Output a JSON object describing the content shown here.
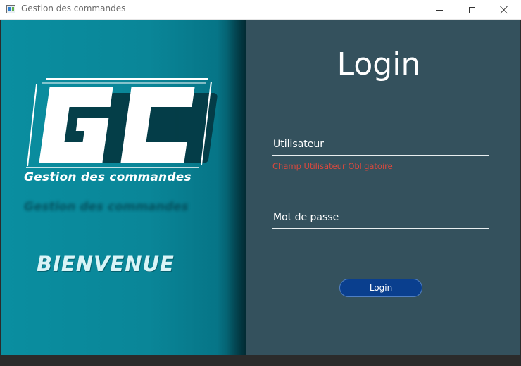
{
  "window": {
    "title": "Gestion des commandes",
    "icon": "app-window-icon",
    "controls": [
      "minimize-icon",
      "maximize-icon",
      "close-icon"
    ]
  },
  "branding": {
    "logo_letters": "GC",
    "logo_subtitle": "Gestion des commandes",
    "welcome": "BIENVENUE"
  },
  "login": {
    "title": "Login",
    "username_placeholder": "Utilisateur",
    "username_error": "Champ Utilisateur Obligatoire",
    "password_placeholder": "Mot de passe",
    "button_label": "Login"
  },
  "colors": {
    "left_panel": "#0a8ea0",
    "right_panel": "#34515d",
    "button": "#0a3f8e",
    "error": "#d9493e"
  }
}
